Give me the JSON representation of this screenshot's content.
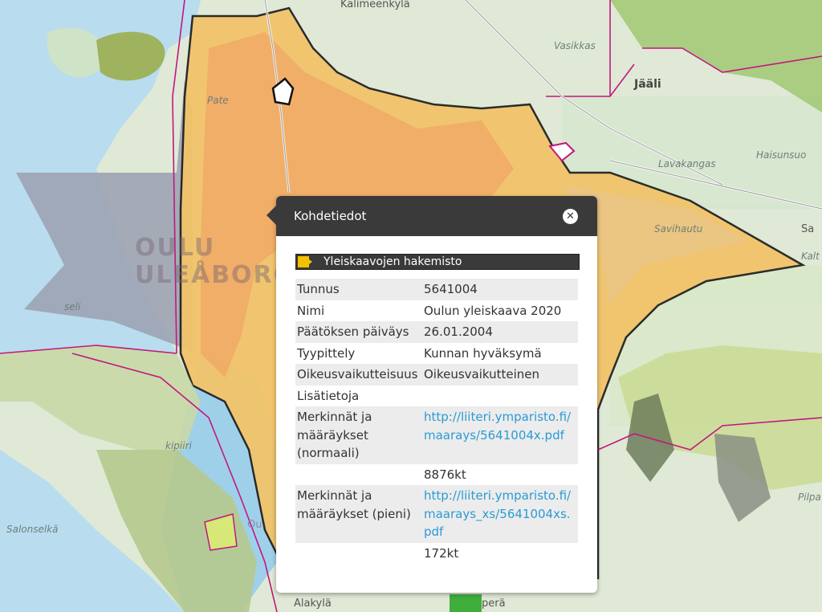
{
  "map": {
    "places": {
      "kalimeenkyla": "Kalimeenkylä",
      "vasikka": "Vasikkas",
      "jaali": "Jääli",
      "lavakangas": "Lavakangas",
      "haisunsuo": "Haisunsuo",
      "savihautu": "Savihautu",
      "oulu_line1": "OULU",
      "oulu_line2": "ULEÅBORG",
      "salonselka": "Salonselkä",
      "alakyla": "Alakylä",
      "pera": "perä",
      "kipiiri": "kipiiri",
      "sa": "Sa",
      "kalt": "Kalt",
      "pilpa": "Pilpa",
      "ou": "Ou",
      "seli": "seli",
      "pate": "Pate"
    },
    "colors": {
      "water": "#b9dcef",
      "land": "#dfe9d6",
      "yleiskaava_fill": "#f2c46a",
      "yleiskaava_border": "#222222",
      "grey_area": "#9aa0b0",
      "magenta_border": "#c2177e"
    }
  },
  "popup": {
    "title": "Kohdetiedot",
    "close_icon": "close-icon",
    "layer": {
      "name": "Yleiskaavojen hakemisto",
      "swatch_color": "#f2c200"
    },
    "rows": [
      {
        "key": "Tunnus",
        "value": "5641004"
      },
      {
        "key": "Nimi",
        "value": "Oulun yleiskaava 2020"
      },
      {
        "key": "Päätöksen päiväys",
        "value": "26.01.2004"
      },
      {
        "key": "Tyypittely",
        "value": "Kunnan hyväksymä"
      },
      {
        "key": "Oikeusvaikutteisuus",
        "value": "Oikeusvaikutteinen"
      },
      {
        "key": "Lisätietoja",
        "value": ""
      }
    ],
    "link_rows": [
      {
        "key": "Merkinnät ja määräykset (normaali)",
        "link": "http://liiteri.ymparisto.fi/maarays/5641004x.pdf",
        "size": "8876kt"
      },
      {
        "key": "Merkinnät ja määräykset (pieni)",
        "link": "http://liiteri.ymparisto.fi/maarays_xs/5641004xs.pdf",
        "size": "172kt"
      }
    ]
  }
}
